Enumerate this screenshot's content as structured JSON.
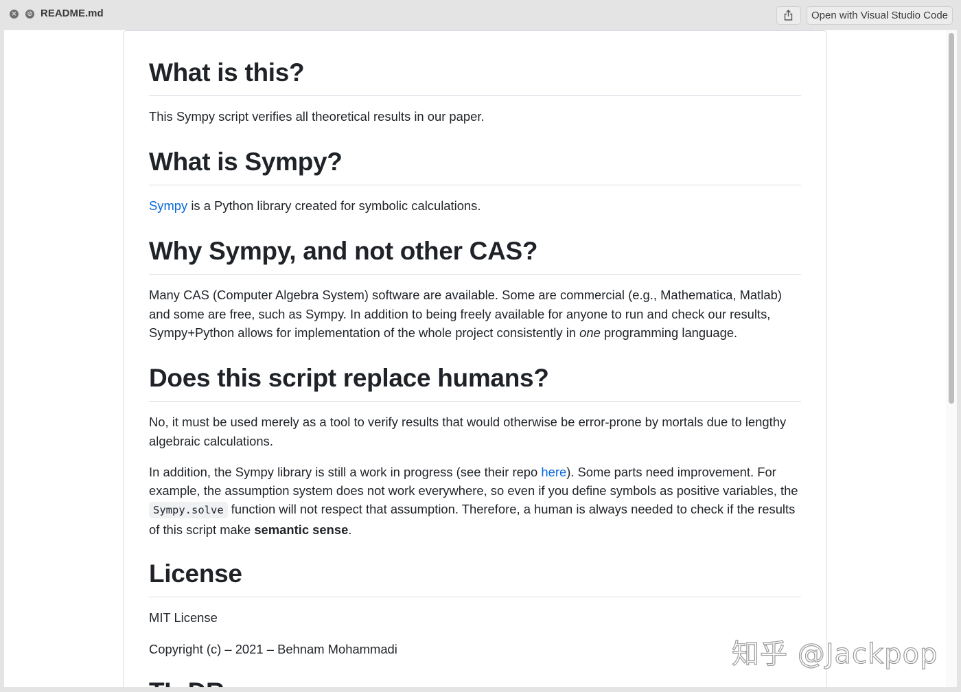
{
  "window": {
    "title": "README.md",
    "open_button_label": "Open with Visual Studio Code"
  },
  "readme": {
    "s1": {
      "heading": "What is this?",
      "text": "This Sympy script verifies all theoretical results in our paper."
    },
    "s2": {
      "heading": "What is Sympy?",
      "link": "Sympy",
      "text": " is a Python library created for symbolic calculations."
    },
    "s3": {
      "heading": "Why Sympy, and not other CAS?",
      "text_a": "Many CAS (Computer Algebra System) software are available. Some are commercial (e.g., Mathematica, Matlab) and some are free, such as Sympy. In addition to being freely available for anyone to run and check our results, Sympy+Python allows for implementation of the whole project consistently in ",
      "emphasis": "one",
      "text_b": " programming language."
    },
    "s4": {
      "heading": "Does this script replace humans?",
      "p1": "No, it must be used merely as a tool to verify results that would otherwise be error-prone by mortals due to lengthy algebraic calculations.",
      "p2_a": "In addition, the Sympy library is still a work in progress (see their repo ",
      "p2_link": "here",
      "p2_b": "). Some parts need improvement. For example, the assumption system does not work everywhere, so even if you define symbols as positive variables, the ",
      "p2_code": "Sympy.solve",
      "p2_c": " function will not respect that assumption. Therefore, a human is always needed to check if the results of this script make ",
      "p2_strong": "semantic sense",
      "p2_d": "."
    },
    "s5": {
      "heading": "License",
      "p1": "MIT License",
      "p2": "Copyright (c) – 2021 – Behnam Mohammadi"
    },
    "s6": {
      "heading": "TL;DR"
    }
  },
  "watermark": "知乎 @Jackpop",
  "colors": {
    "link": "#0969da",
    "text": "#1f2328",
    "divider": "#d8dee4"
  }
}
